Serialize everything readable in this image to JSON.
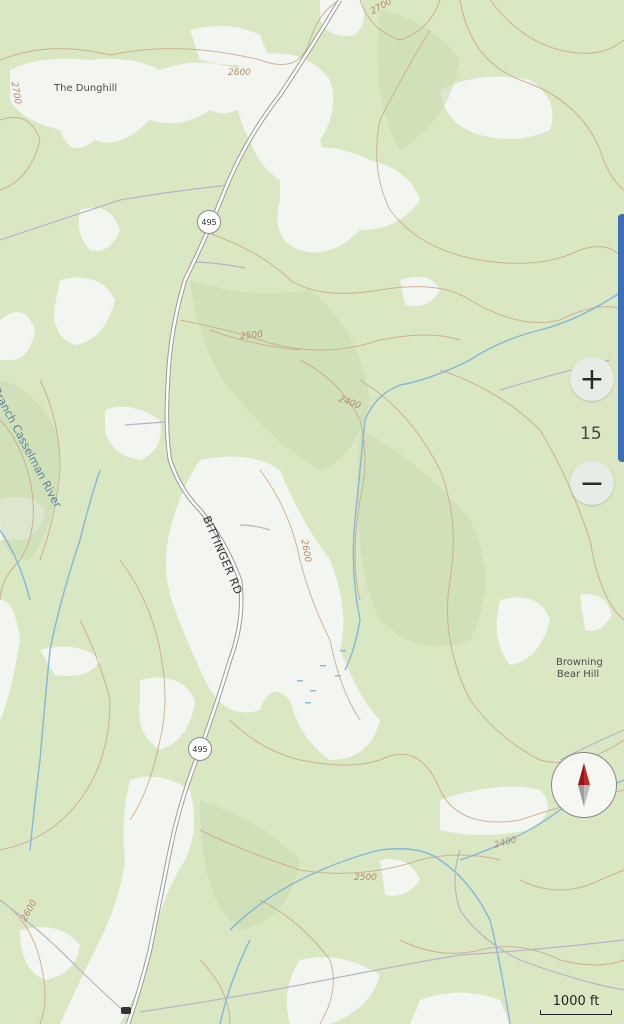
{
  "map": {
    "place_labels": {
      "dunghill": "The Dunghill",
      "casselman_river": "th Branch Casselman River",
      "road_name": "BITTINGER RD",
      "browning_bear_hill_line1": "Browning",
      "browning_bear_hill_line2": "Bear Hill"
    },
    "contour_labels": {
      "c2700_top": "2700",
      "c2700_left": "2700",
      "c2600_top": "2600",
      "c2500_mid": "2500",
      "c2400_mid": "2400",
      "c2600_road": "2600",
      "c2400_right": "2400",
      "c2500_bottom": "2500",
      "c2600_bottom_left": "2600"
    },
    "route_shields": {
      "upper": "495",
      "lower": "495"
    },
    "colors": {
      "forest": "#d8e6c2",
      "clearing": "#f4f6f1",
      "contour": "#c9a98c",
      "water": "#7bb0d4",
      "road": "#ffffff",
      "road_casing": "#9a9a9a"
    }
  },
  "controls": {
    "zoom_in_label": "+",
    "zoom_out_label": "−",
    "zoom_level": "15",
    "compass_icon": "compass-icon",
    "scale_label": "1000 ft"
  }
}
